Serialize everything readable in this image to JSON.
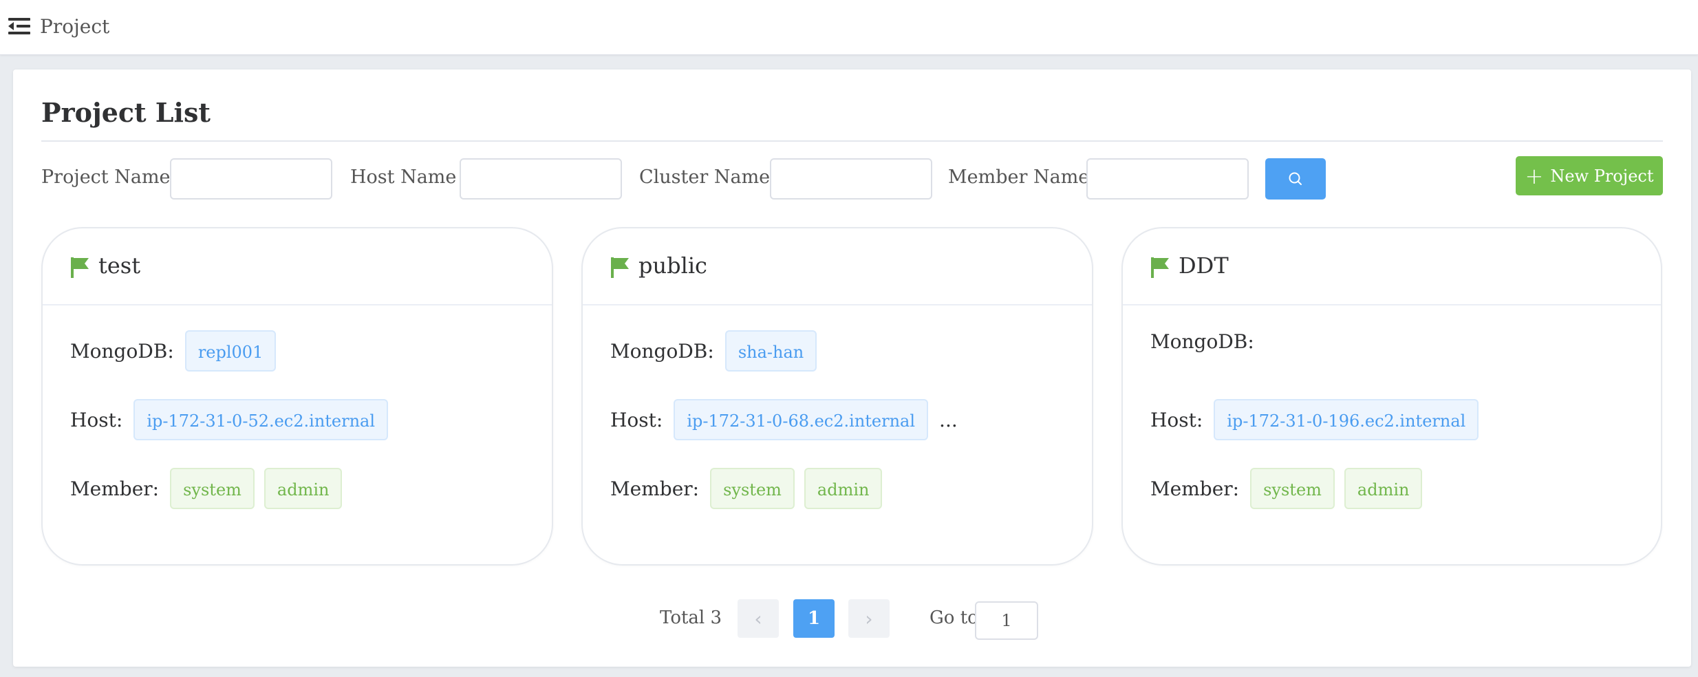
{
  "header": {
    "title": "Project",
    "menu_icon": "menu-fold-icon"
  },
  "page": {
    "title": "Project List"
  },
  "filters": {
    "project_name_label": "Project Name",
    "project_name_value": "",
    "host_name_label": "Host Name",
    "host_name_value": "",
    "cluster_name_label": "Cluster Name",
    "cluster_name_value": "",
    "member_name_label": "Member Name",
    "member_name_value": "",
    "search_icon": "search-icon",
    "new_project_label": "New Project",
    "new_project_icon": "plus-icon"
  },
  "labels": {
    "mongodb": "MongoDB:",
    "host": "Host:",
    "member": "Member:"
  },
  "projects": [
    {
      "name": "test",
      "mongodb": [
        "repl001"
      ],
      "hosts": [
        "ip-172-31-0-52.ec2.internal"
      ],
      "more_hosts": "",
      "members": [
        "system",
        "admin"
      ]
    },
    {
      "name": "public",
      "mongodb": [
        "sha-han"
      ],
      "hosts": [
        "ip-172-31-0-68.ec2.internal"
      ],
      "more_hosts": "...",
      "members": [
        "system",
        "admin"
      ]
    },
    {
      "name": "DDT",
      "mongodb": [],
      "hosts": [
        "ip-172-31-0-196.ec2.internal"
      ],
      "more_hosts": "",
      "members": [
        "system",
        "admin"
      ]
    }
  ],
  "pagination": {
    "total_text": "Total 3",
    "current_page": "1",
    "goto_label": "Go to",
    "goto_value": "1"
  },
  "colors": {
    "primary": "#4ea1f3",
    "success": "#74c04b",
    "flag": "#6ab04c"
  }
}
